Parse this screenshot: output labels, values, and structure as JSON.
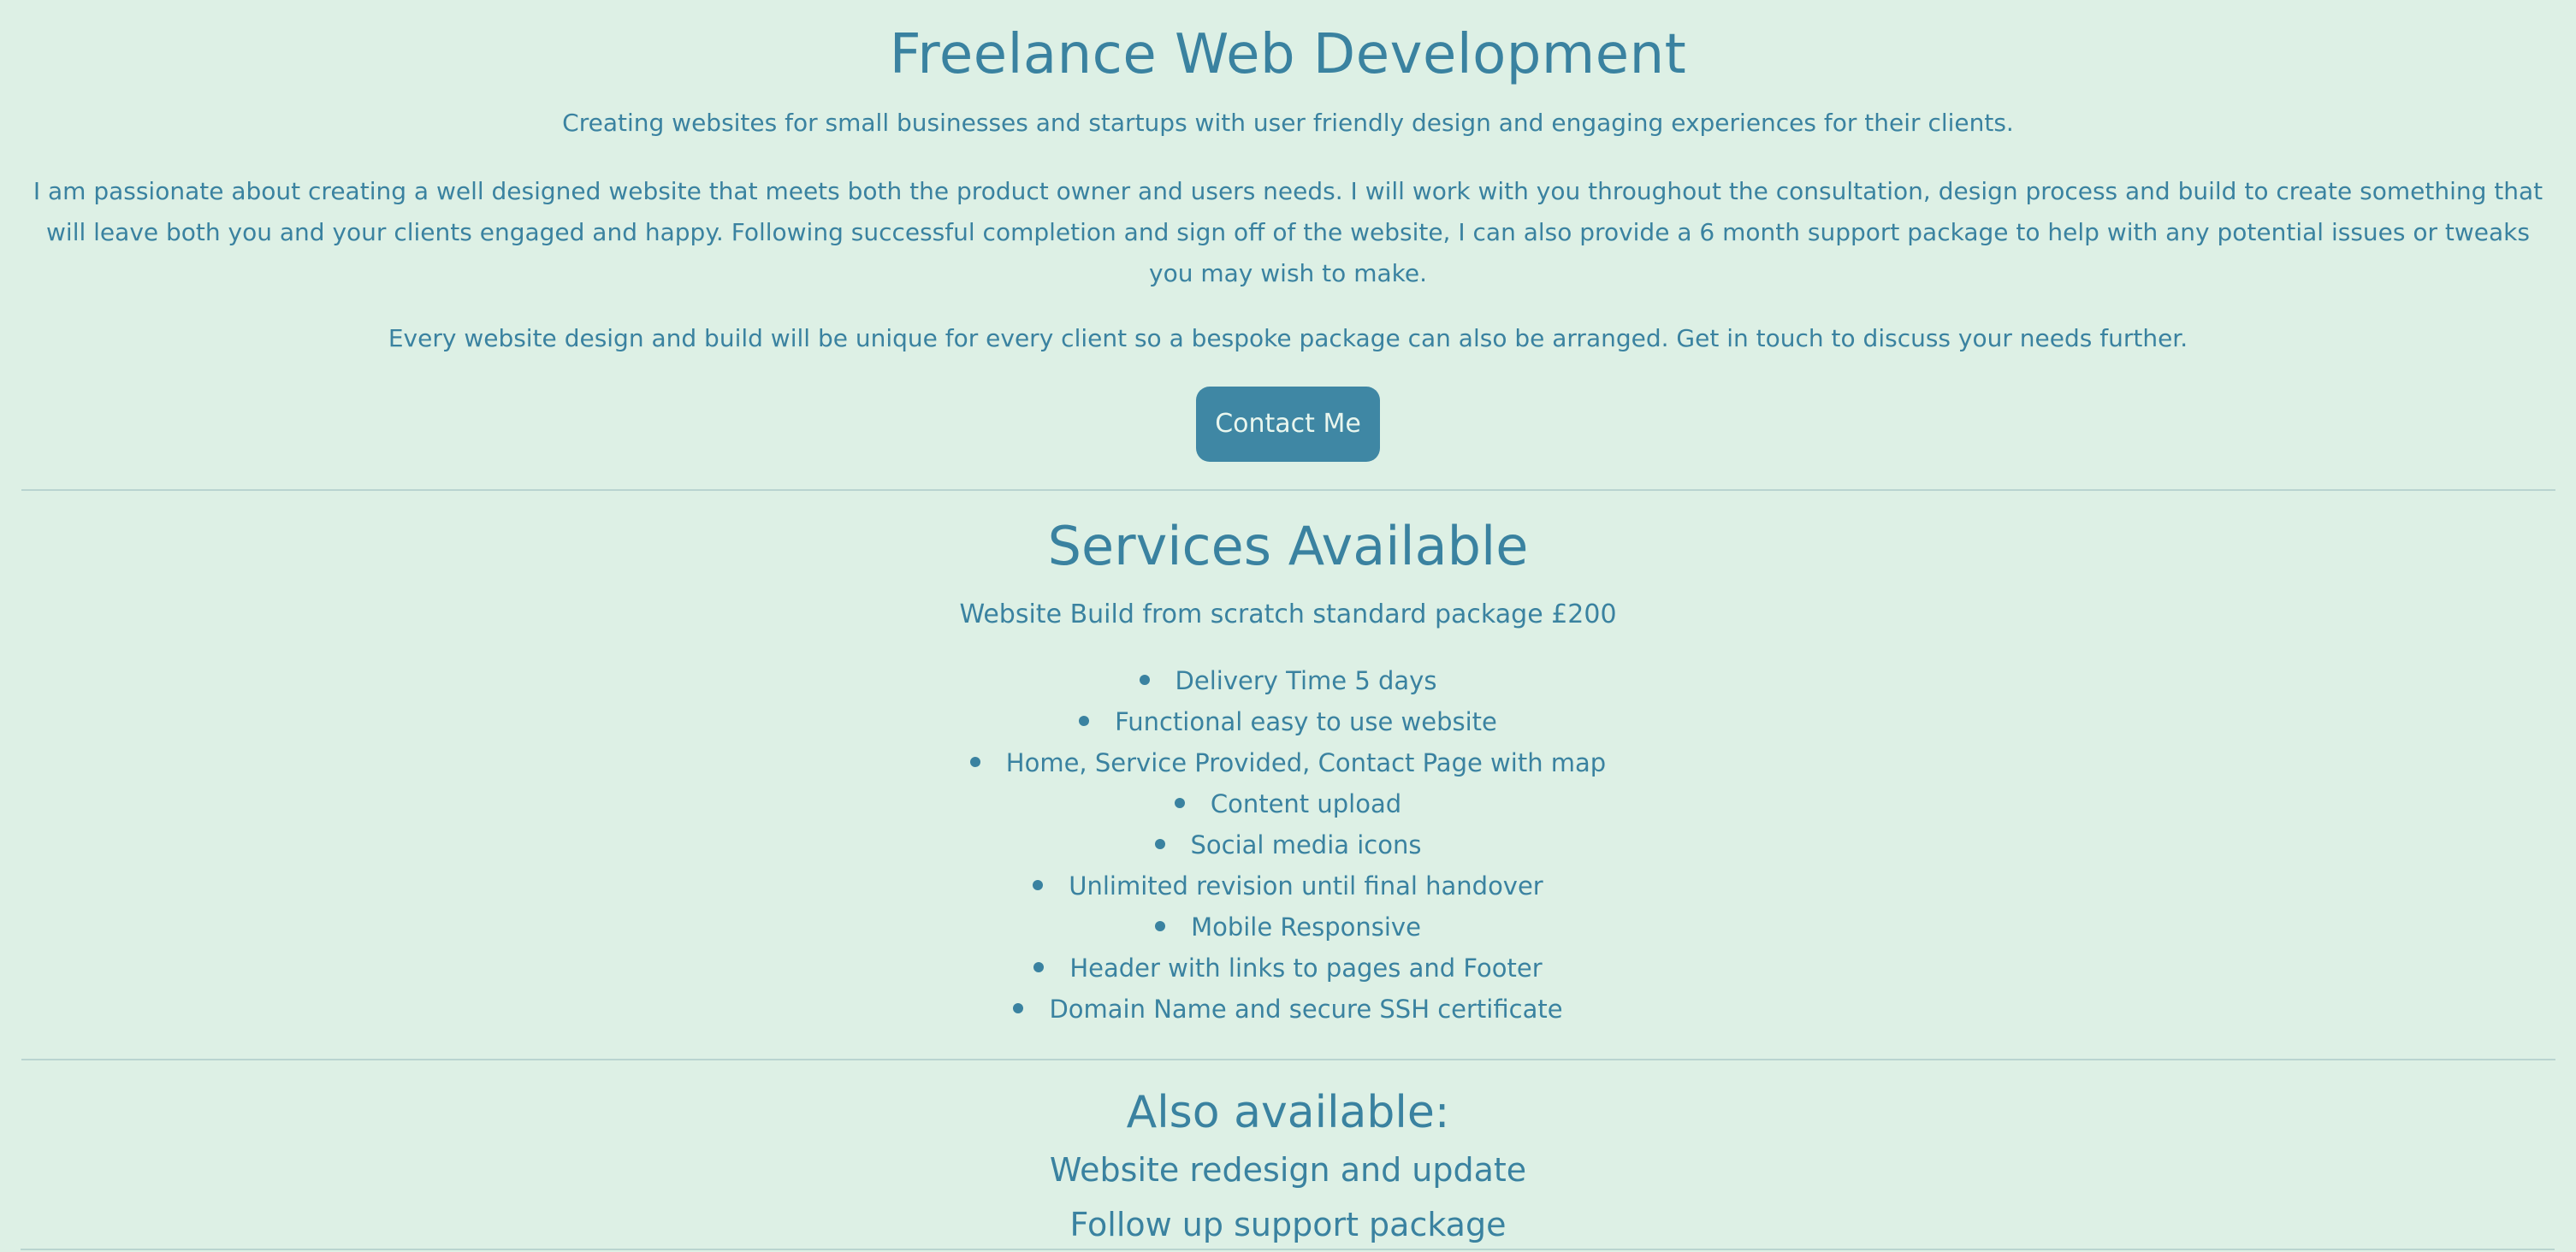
{
  "hero": {
    "title": "Freelance Web Development",
    "tagline": "Creating websites for small businesses and startups with user friendly design and engaging experiences for their clients.",
    "intro": "I am passionate about creating a well designed website that meets both the product owner and users needs. I will work with you throughout the consultation, design process and build to create something that will leave both you and your clients engaged and happy. Following successful completion and sign off of the website, I can also provide a 6 month support package to help with any potential issues or tweaks you may wish to make.",
    "bespoke": "Every website design and build will be unique for every client so a bespoke package can also be arranged. Get in touch to discuss your needs further.",
    "contact_label": "Contact Me"
  },
  "services": {
    "title": "Services Available",
    "package": "Website Build from scratch standard package £200",
    "features": [
      "Delivery Time 5 days",
      "Functional easy to use website",
      "Home, Service Provided, Contact Page with map",
      "Content upload",
      "Social media icons",
      "Unlimited revision until final handover",
      "Mobile Responsive",
      "Header with links to pages and Footer",
      "Domain Name and secure SSH certificate"
    ]
  },
  "also": {
    "title": "Also available:",
    "items": [
      "Website redesign and update",
      "Follow up support package"
    ]
  },
  "colors": {
    "background": "#ddf0e5",
    "text": "#3a82a0",
    "button": "#3f87a4",
    "divider": "#b9d4d0"
  }
}
